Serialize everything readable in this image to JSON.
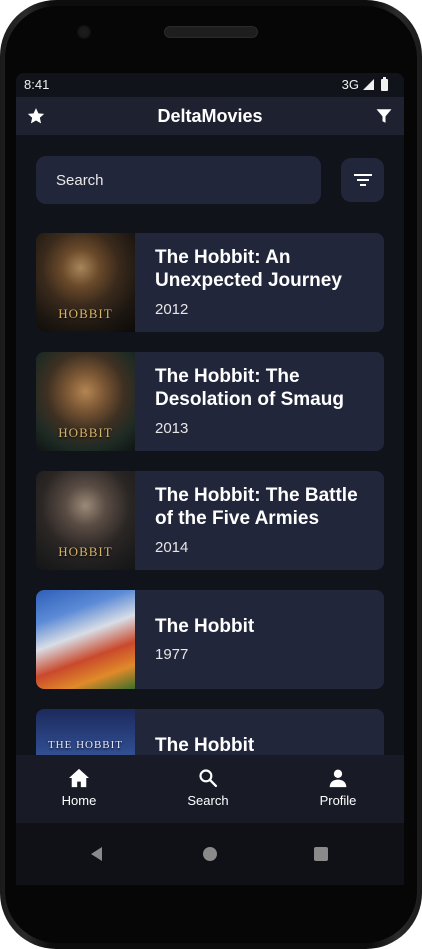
{
  "status_bar": {
    "time": "8:41",
    "network": "3G"
  },
  "app_bar": {
    "title": "DeltaMovies",
    "left_icon": "star-icon",
    "right_icon": "filter-icon"
  },
  "search": {
    "placeholder": "Search",
    "value": "",
    "sort_icon": "sort-lines-icon"
  },
  "movies": [
    {
      "title": "The Hobbit: An Unexpected Journey",
      "year": "2012",
      "poster_text": "HOBBIT"
    },
    {
      "title": "The Hobbit: The Desolation of Smaug",
      "year": "2013",
      "poster_text": "HOBBIT"
    },
    {
      "title": "The Hobbit: The Battle of the Five Armies",
      "year": "2014",
      "poster_text": "HOBBIT"
    },
    {
      "title": "The Hobbit",
      "year": "1977",
      "poster_text": ""
    },
    {
      "title": "The Hobbit",
      "year": "",
      "poster_text": "THE HOBBIT"
    }
  ],
  "bottom_nav": [
    {
      "label": "Home",
      "icon": "home-icon"
    },
    {
      "label": "Search",
      "icon": "search-icon"
    },
    {
      "label": "Profile",
      "icon": "person-icon"
    }
  ],
  "colors": {
    "background": "#11131a",
    "card": "#22263a",
    "app_bar": "#1e2230",
    "text": "#ffffff"
  }
}
